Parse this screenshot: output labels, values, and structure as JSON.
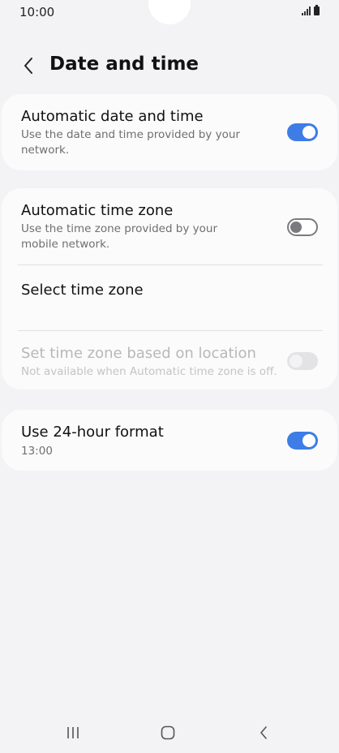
{
  "status_bar": {
    "time": "10:00",
    "signal_icon": "signal-icon",
    "battery_icon": "battery-icon"
  },
  "header": {
    "back_icon": "chevron-left-icon",
    "title": "Date and time"
  },
  "settings": {
    "automatic_date_time": {
      "title": "Automatic date and time",
      "subtitle": "Use the date and time provided by your network.",
      "enabled": true
    },
    "automatic_time_zone": {
      "title": "Automatic time zone",
      "subtitle": "Use the time zone provided by your mobile network.",
      "enabled": false
    },
    "select_time_zone": {
      "title": "Select time zone"
    },
    "location_time_zone": {
      "title": "Set time zone based on location",
      "subtitle": "Not available when Automatic time zone is off.",
      "enabled": false,
      "disabled": true
    },
    "use_24_hour": {
      "title": "Use 24-hour format",
      "subtitle": "13:00",
      "enabled": true
    }
  },
  "colors": {
    "accent": "#3e7ce6",
    "background": "#f3f3f5",
    "card": "#fbfbfc"
  },
  "nav_bar": {
    "recents_icon": "recents-icon",
    "home_icon": "home-icon",
    "back_icon": "back-icon"
  }
}
